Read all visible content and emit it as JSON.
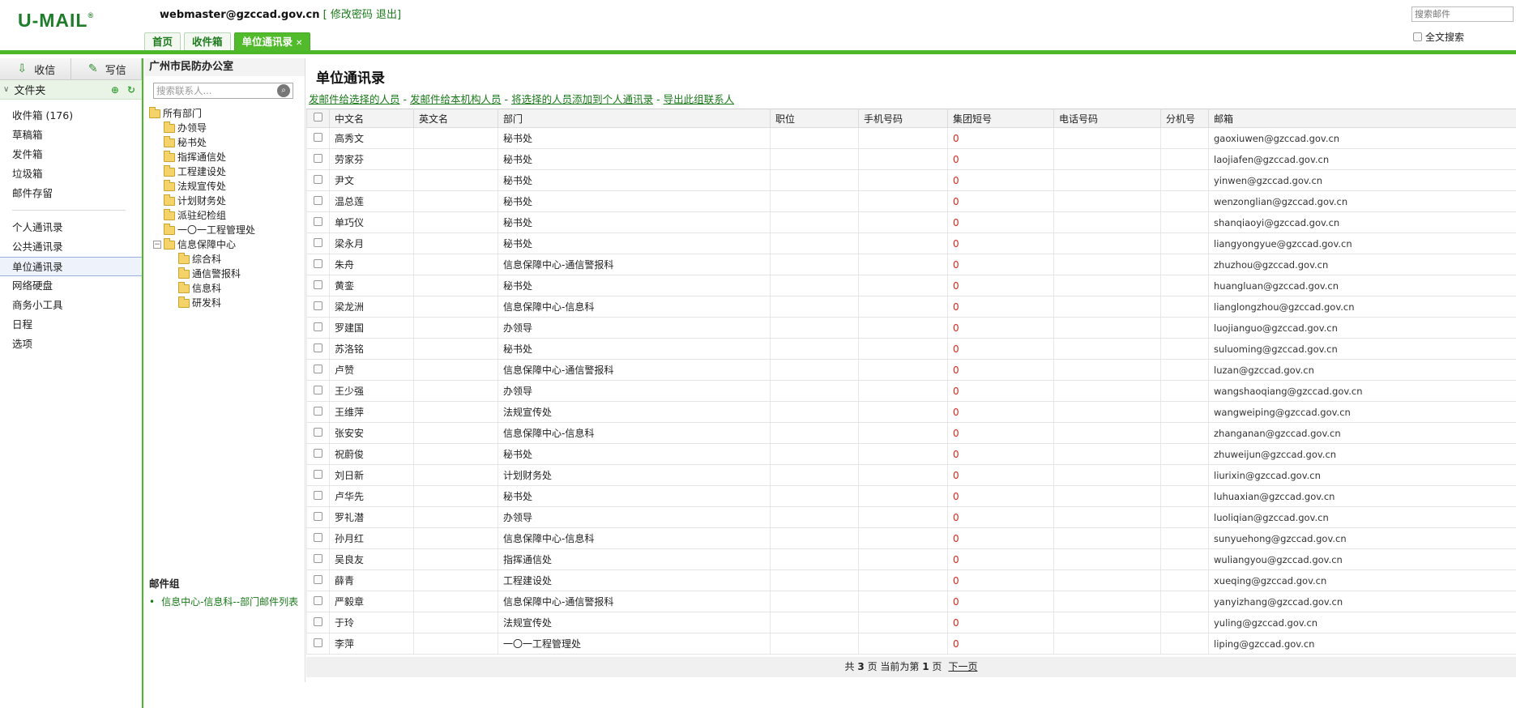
{
  "header": {
    "logo": "U-MAIL",
    "logo_mark": "®",
    "user_email": "webmaster@gzccad.gov.cn",
    "change_password": "修改密码",
    "logout": "退出",
    "search_placeholder": "搜索邮件",
    "fulltext_label": "全文搜索",
    "tabs": [
      {
        "label": "首页"
      },
      {
        "label": "收件箱"
      },
      {
        "label": "单位通讯录",
        "close": "✕"
      }
    ]
  },
  "sidebar": {
    "receive_label": "收信",
    "compose_label": "写信",
    "folder_label": "文件夹",
    "items_group1": [
      "收件箱 (176)",
      "草稿箱",
      "发件箱",
      "垃圾箱",
      "邮件存留"
    ],
    "items_group2": [
      "个人通讯录",
      "公共通讯录",
      "单位通讯录",
      "网络硬盘",
      "商务小工具",
      "日程",
      "选项"
    ],
    "active_item": "单位通讯录"
  },
  "tree_panel": {
    "org_name": "广州市民防办公室",
    "search_placeholder": "搜索联系人...",
    "root": "所有部门",
    "departments": [
      "办领导",
      "秘书处",
      "指挥通信处",
      "工程建设处",
      "法规宣传处",
      "计划财务处",
      "派驻纪检组",
      "一〇一工程管理处"
    ],
    "info_center": "信息保障中心",
    "info_center_children": [
      "综合科",
      "通信警报科",
      "信息科",
      "研发科"
    ],
    "mailgroup_title": "邮件组",
    "mailgroups": [
      "信息中心-信息科--部门邮件列表"
    ]
  },
  "main": {
    "title": "单位通讯录",
    "actions": [
      "发邮件给选择的人员",
      "发邮件给本机构人员",
      "将选择的人员添加到个人通讯录",
      "导出此组联系人"
    ],
    "columns": [
      "中文名",
      "英文名",
      "部门",
      "职位",
      "手机号码",
      "集团短号",
      "电话号码",
      "分机号",
      "邮箱"
    ],
    "rows": [
      {
        "name": "高秀文",
        "dept": "秘书处",
        "short": "0",
        "email": "gaoxiuwen@gzccad.gov.cn"
      },
      {
        "name": "劳家芬",
        "dept": "秘书处",
        "short": "0",
        "email": "laojiafen@gzccad.gov.cn"
      },
      {
        "name": "尹文",
        "dept": "秘书处",
        "short": "0",
        "email": "yinwen@gzccad.gov.cn"
      },
      {
        "name": "温总莲",
        "dept": "秘书处",
        "short": "0",
        "email": "wenzonglian@gzccad.gov.cn"
      },
      {
        "name": "单巧仪",
        "dept": "秘书处",
        "short": "0",
        "email": "shanqiaoyi@gzccad.gov.cn"
      },
      {
        "name": "梁永月",
        "dept": "秘书处",
        "short": "0",
        "email": "liangyongyue@gzccad.gov.cn"
      },
      {
        "name": "朱舟",
        "dept": "信息保障中心-通信警报科",
        "short": "0",
        "email": "zhuzhou@gzccad.gov.cn"
      },
      {
        "name": "黄銮",
        "dept": "秘书处",
        "short": "0",
        "email": "huangluan@gzccad.gov.cn"
      },
      {
        "name": "梁龙洲",
        "dept": "信息保障中心-信息科",
        "short": "0",
        "email": "lianglongzhou@gzccad.gov.cn"
      },
      {
        "name": "罗建国",
        "dept": "办领导",
        "short": "0",
        "email": "luojianguo@gzccad.gov.cn"
      },
      {
        "name": "苏洛铭",
        "dept": "秘书处",
        "short": "0",
        "email": "suluoming@gzccad.gov.cn"
      },
      {
        "name": "卢赞",
        "dept": "信息保障中心-通信警报科",
        "short": "0",
        "email": "luzan@gzccad.gov.cn"
      },
      {
        "name": "王少强",
        "dept": "办领导",
        "short": "0",
        "email": "wangshaoqiang@gzccad.gov.cn"
      },
      {
        "name": "王维萍",
        "dept": "法规宣传处",
        "short": "0",
        "email": "wangweiping@gzccad.gov.cn"
      },
      {
        "name": "张安安",
        "dept": "信息保障中心-信息科",
        "short": "0",
        "email": "zhanganan@gzccad.gov.cn"
      },
      {
        "name": "祝蔚俊",
        "dept": "秘书处",
        "short": "0",
        "email": "zhuweijun@gzccad.gov.cn"
      },
      {
        "name": "刘日新",
        "dept": "计划财务处",
        "short": "0",
        "email": "liurixin@gzccad.gov.cn"
      },
      {
        "name": "卢华先",
        "dept": "秘书处",
        "short": "0",
        "email": "luhuaxian@gzccad.gov.cn"
      },
      {
        "name": "罗礼潜",
        "dept": "办领导",
        "short": "0",
        "email": "luoliqian@gzccad.gov.cn"
      },
      {
        "name": "孙月红",
        "dept": "信息保障中心-信息科",
        "short": "0",
        "email": "sunyuehong@gzccad.gov.cn"
      },
      {
        "name": "吴良友",
        "dept": "指挥通信处",
        "short": "0",
        "email": "wuliangyou@gzccad.gov.cn"
      },
      {
        "name": "薛青",
        "dept": "工程建设处",
        "short": "0",
        "email": "xueqing@gzccad.gov.cn"
      },
      {
        "name": "严毅章",
        "dept": "信息保障中心-通信警报科",
        "short": "0",
        "email": "yanyizhang@gzccad.gov.cn"
      },
      {
        "name": "于玲",
        "dept": "法规宣传处",
        "short": "0",
        "email": "yuling@gzccad.gov.cn"
      },
      {
        "name": "李萍",
        "dept": "一〇一工程管理处",
        "short": "0",
        "email": "liping@gzccad.gov.cn"
      }
    ],
    "pager": {
      "prefix": "共",
      "total": "3",
      "mid": "页 当前为第",
      "current": "1",
      "suffix": "页",
      "next": "下一页"
    }
  }
}
